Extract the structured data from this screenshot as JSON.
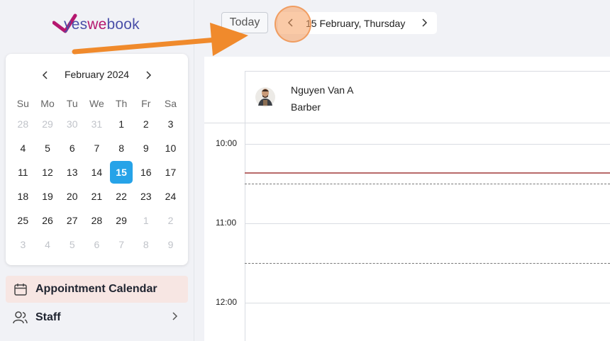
{
  "logo": {
    "part1": "yes",
    "part2": "we",
    "part3": "book"
  },
  "mini_calendar": {
    "title": "February 2024",
    "weekdays": [
      "Su",
      "Mo",
      "Tu",
      "We",
      "Th",
      "Fr",
      "Sa"
    ],
    "weeks": [
      [
        {
          "d": "28",
          "m": true
        },
        {
          "d": "29",
          "m": true
        },
        {
          "d": "30",
          "m": true
        },
        {
          "d": "31",
          "m": true
        },
        {
          "d": "1"
        },
        {
          "d": "2"
        },
        {
          "d": "3"
        }
      ],
      [
        {
          "d": "4"
        },
        {
          "d": "5"
        },
        {
          "d": "6"
        },
        {
          "d": "7"
        },
        {
          "d": "8"
        },
        {
          "d": "9"
        },
        {
          "d": "10"
        }
      ],
      [
        {
          "d": "11"
        },
        {
          "d": "12"
        },
        {
          "d": "13"
        },
        {
          "d": "14"
        },
        {
          "d": "15",
          "s": true
        },
        {
          "d": "16"
        },
        {
          "d": "17"
        }
      ],
      [
        {
          "d": "18"
        },
        {
          "d": "19"
        },
        {
          "d": "20"
        },
        {
          "d": "21"
        },
        {
          "d": "22"
        },
        {
          "d": "23"
        },
        {
          "d": "24"
        }
      ],
      [
        {
          "d": "25"
        },
        {
          "d": "26"
        },
        {
          "d": "27"
        },
        {
          "d": "28"
        },
        {
          "d": "29"
        },
        {
          "d": "1",
          "m": true
        },
        {
          "d": "2",
          "m": true
        }
      ],
      [
        {
          "d": "3",
          "m": true
        },
        {
          "d": "4",
          "m": true
        },
        {
          "d": "5",
          "m": true
        },
        {
          "d": "6",
          "m": true
        },
        {
          "d": "7",
          "m": true
        },
        {
          "d": "8",
          "m": true
        },
        {
          "d": "9",
          "m": true
        }
      ]
    ]
  },
  "nav": {
    "appointment_calendar": "Appointment Calendar",
    "staff": "Staff"
  },
  "toolbar": {
    "today_label": "Today",
    "date_label": "15 February, Thursday"
  },
  "staff_column": {
    "name": "Nguyen Van A",
    "role": "Barber"
  },
  "time_slots": [
    "10:00",
    "11:00",
    "12:00"
  ],
  "colors": {
    "accent": "#26a3e8",
    "active_nav_bg": "#f7e6e3",
    "now_line": "#b86a6a",
    "annotation_arrow": "#f08a2c"
  }
}
